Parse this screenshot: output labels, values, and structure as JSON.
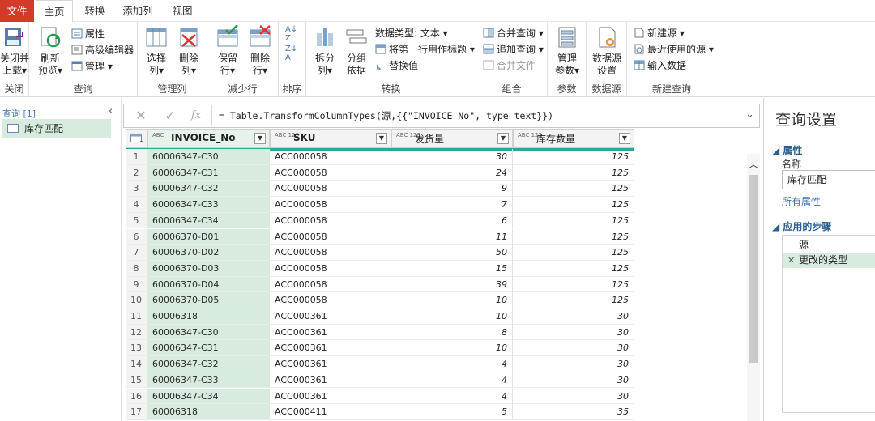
{
  "tabs": {
    "file": "文件",
    "home": "主页",
    "transform": "转换",
    "add_column": "添加列",
    "view": "视图"
  },
  "ribbon": {
    "close_apply": [
      "关闭并",
      "上载"
    ],
    "refresh": [
      "刷新",
      "预览"
    ],
    "properties": "属性",
    "advanced_editor": "高级编辑器",
    "manage": "管理",
    "choose_cols": [
      "选择",
      "列"
    ],
    "remove_cols": [
      "删除",
      "列"
    ],
    "keep_rows": [
      "保留",
      "行"
    ],
    "remove_rows": [
      "删除",
      "行"
    ],
    "split_col": [
      "拆分",
      "列"
    ],
    "group_by": [
      "分组",
      "依据"
    ],
    "data_type": "数据类型: 文本",
    "first_row_header": "将第一行用作标题",
    "replace_values": "替换值",
    "merge_queries": "合并查询",
    "append_queries": "追加查询",
    "combine_files": "合并文件",
    "manage_params": [
      "管理",
      "参数"
    ],
    "data_source_settings": [
      "数据源",
      "设置"
    ],
    "new_source": "新建源",
    "recent_sources": "最近使用的源",
    "enter_data": "输入数据",
    "groups": {
      "close": "关闭",
      "query": "查询",
      "manage_cols": "管理列",
      "reduce_rows": "减少行",
      "sort": "排序",
      "transform": "转换",
      "combine": "组合",
      "params": "参数",
      "data_source": "数据源",
      "new_query": "新建查询"
    }
  },
  "nav": {
    "header": "查询 [1]",
    "collapse": "‹",
    "item": "库存匹配"
  },
  "formula": {
    "cancel": "✕",
    "commit": "✓",
    "fx": "fx",
    "text": "= Table.TransformColumnTypes(源,{{\"INVOICE_No\", type text}})"
  },
  "columns": [
    {
      "type": "ABC",
      "name": "INVOICE_No"
    },
    {
      "type": "ABC 123",
      "name": "SKU"
    },
    {
      "type": "ABC 123",
      "name": "发货量"
    },
    {
      "type": "ABC 123",
      "name": "库存数量"
    }
  ],
  "rows": [
    [
      "1",
      "60006347-C30",
      "ACC000058",
      "30",
      "125"
    ],
    [
      "2",
      "60006347-C31",
      "ACC000058",
      "24",
      "125"
    ],
    [
      "3",
      "60006347-C32",
      "ACC000058",
      "9",
      "125"
    ],
    [
      "4",
      "60006347-C33",
      "ACC000058",
      "7",
      "125"
    ],
    [
      "5",
      "60006347-C34",
      "ACC000058",
      "6",
      "125"
    ],
    [
      "6",
      "60006370-D01",
      "ACC000058",
      "11",
      "125"
    ],
    [
      "7",
      "60006370-D02",
      "ACC000058",
      "50",
      "125"
    ],
    [
      "8",
      "60006370-D03",
      "ACC000058",
      "15",
      "125"
    ],
    [
      "9",
      "60006370-D04",
      "ACC000058",
      "39",
      "125"
    ],
    [
      "10",
      "60006370-D05",
      "ACC000058",
      "10",
      "125"
    ],
    [
      "11",
      "60006318",
      "ACC000361",
      "10",
      "30"
    ],
    [
      "12",
      "60006347-C30",
      "ACC000361",
      "8",
      "30"
    ],
    [
      "13",
      "60006347-C31",
      "ACC000361",
      "10",
      "30"
    ],
    [
      "14",
      "60006347-C32",
      "ACC000361",
      "4",
      "30"
    ],
    [
      "15",
      "60006347-C33",
      "ACC000361",
      "4",
      "30"
    ],
    [
      "16",
      "60006347-C34",
      "ACC000361",
      "4",
      "30"
    ],
    [
      "17",
      "60006318",
      "ACC000411",
      "5",
      "35"
    ]
  ],
  "settings": {
    "title": "查询设置",
    "properties_header": "属性",
    "name_label": "名称",
    "name_value": "库存匹配",
    "all_properties": "所有属性",
    "steps_header": "应用的步骤",
    "steps": [
      "源",
      "更改的类型"
    ]
  },
  "colors": {
    "file_tab": "#d23b2a",
    "selected_column": "#d7ecdf",
    "header_accent": "#2aa99b"
  }
}
